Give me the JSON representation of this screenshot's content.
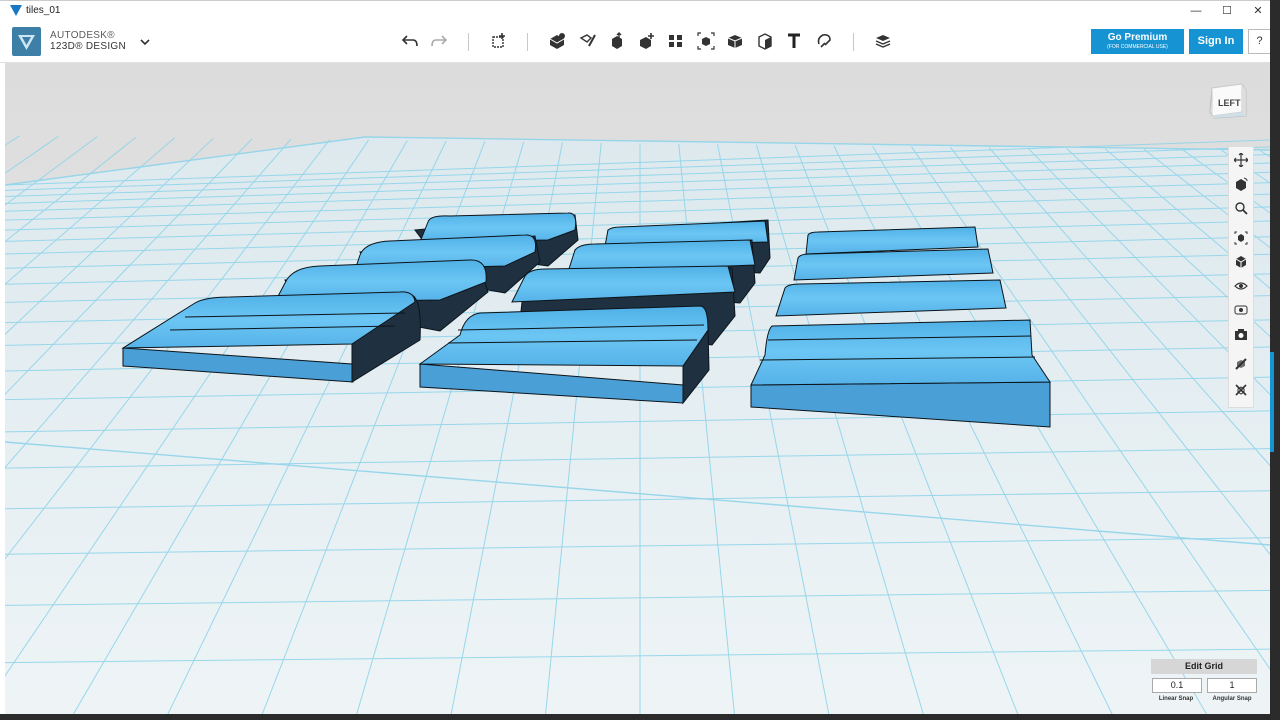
{
  "window": {
    "title": "tiles_01",
    "controls": {
      "minimize": "—",
      "maximize": "☐",
      "close": "✕"
    }
  },
  "brand": {
    "line1": "AUTODESK®",
    "line2": "123D® DESIGN",
    "menu_icon": "chevron-down-icon"
  },
  "toolbar": {
    "tools": [
      "undo-icon",
      "redo-icon",
      "transform-icon",
      "primitives-icon",
      "sketch-icon",
      "construct-icon",
      "modify-icon",
      "pattern-icon",
      "grouping-icon",
      "combine-icon",
      "measure-icon",
      "text-icon",
      "snap-icon",
      "material-icon"
    ]
  },
  "buttons": {
    "premium_line1": "Go Premium",
    "premium_line2": "(FOR COMMERCIAL USE)",
    "signin": "Sign In",
    "help": "?"
  },
  "viewcube": {
    "face": "LEFT"
  },
  "nav_tools": [
    "pan-icon",
    "orbit-icon",
    "zoom-icon",
    "fit-icon",
    "view-mode-icon",
    "visibility-icon",
    "materials-icon",
    "camera-icon",
    "snap-on-icon",
    "snap-off-icon"
  ],
  "grid": {
    "edit_label": "Edit Grid",
    "linear_snap": "0.1",
    "linear_label": "Linear Snap",
    "angular_snap": "1",
    "angular_label": "Angular Snap"
  },
  "colors": {
    "accent": "#1693d2",
    "tile_top": "#5fb8ea",
    "tile_front": "#4a9fd6",
    "tile_shadow": "#1f3140",
    "grid": "#7fd3ec",
    "floor": "#e8f1f4"
  }
}
